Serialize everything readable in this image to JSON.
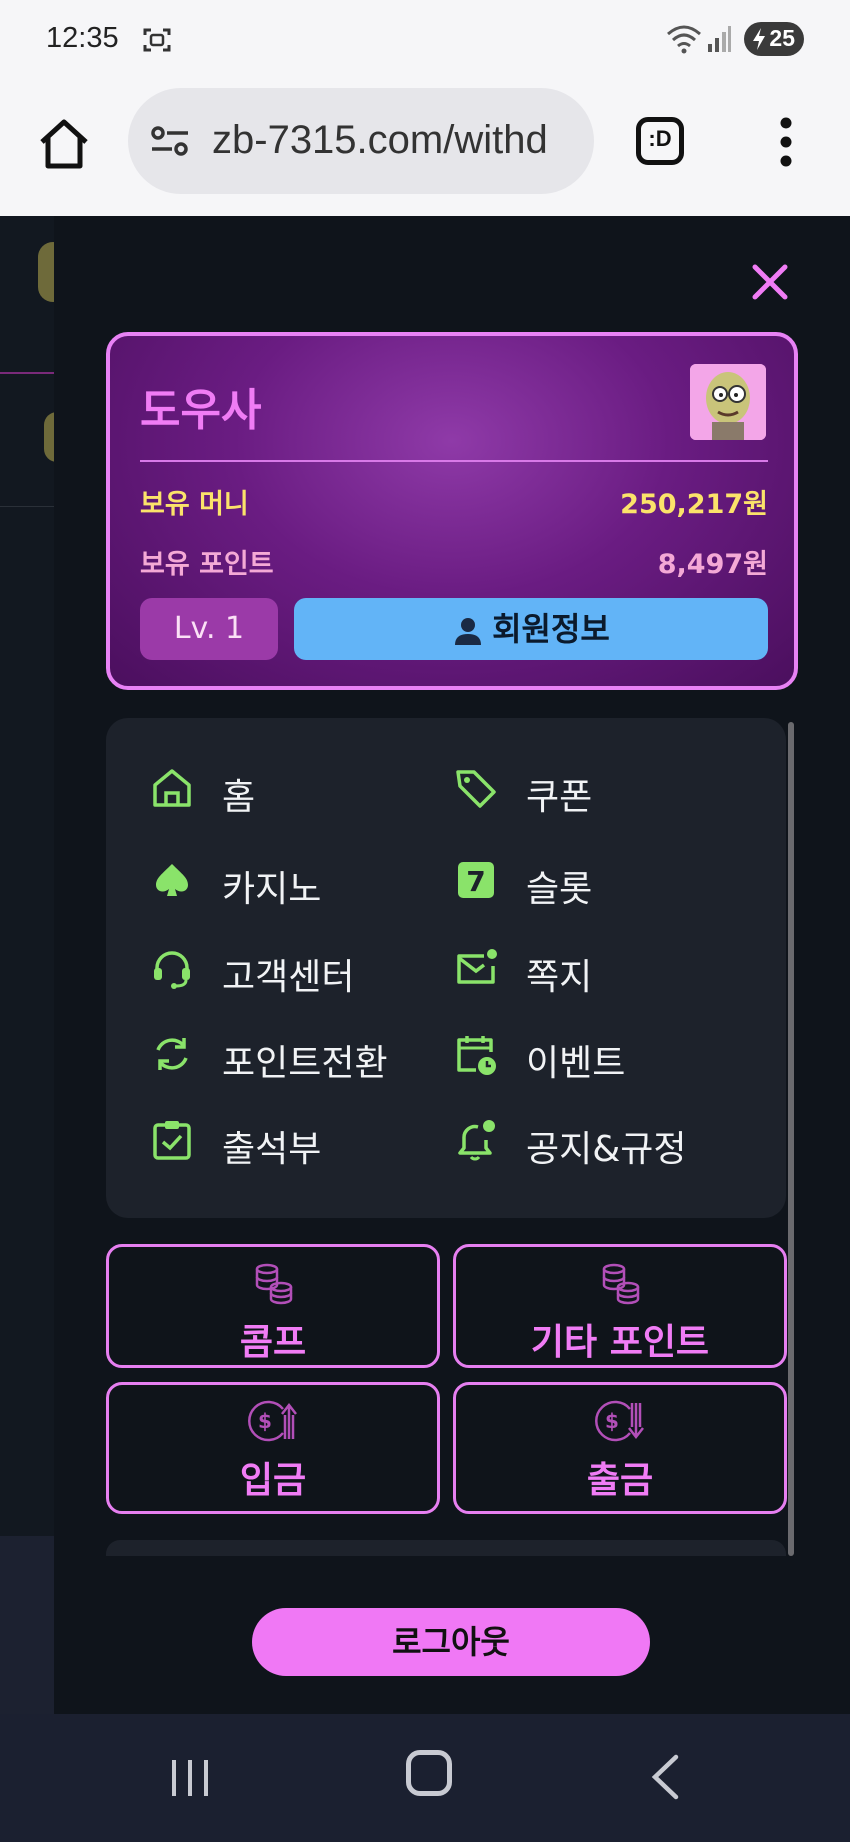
{
  "status_bar": {
    "time": "12:35",
    "battery": "25"
  },
  "browser": {
    "url": "zb-7315.com/withd",
    "tab_label": ":D"
  },
  "profile": {
    "username": "도우사",
    "money_label": "보유 머니",
    "money_value": "250,217원",
    "point_label": "보유 포인트",
    "point_value": "8,497원",
    "level": "Lv. 1",
    "member_info_label": "회원정보"
  },
  "menu": {
    "items": [
      {
        "label": "홈",
        "icon": "home-icon"
      },
      {
        "label": "쿠폰",
        "icon": "tag-icon"
      },
      {
        "label": "카지노",
        "icon": "spade-icon"
      },
      {
        "label": "슬롯",
        "icon": "slot-7-icon"
      },
      {
        "label": "고객센터",
        "icon": "headset-icon"
      },
      {
        "label": "쪽지",
        "icon": "mail-icon"
      },
      {
        "label": "포인트전환",
        "icon": "refresh-icon"
      },
      {
        "label": "이벤트",
        "icon": "calendar-icon"
      },
      {
        "label": "출석부",
        "icon": "checklist-icon"
      },
      {
        "label": "공지&규정",
        "icon": "bell-icon"
      }
    ]
  },
  "buttons": {
    "comp": "콤프",
    "other_point": "기타 포인트",
    "deposit": "입금",
    "withdraw": "출금",
    "logout": "로그아웃"
  },
  "colors": {
    "accent_pink": "#f07cf5",
    "icon_green": "#8ae36a",
    "money_yellow": "#fbe36a",
    "info_blue": "#62b4f7"
  }
}
